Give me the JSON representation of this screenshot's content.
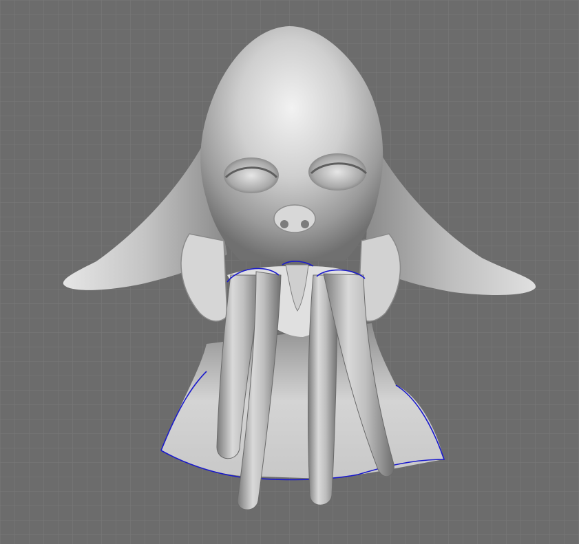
{
  "viewport": {
    "background_color": "#6d6d6d",
    "grid_color": "#7f7f7f",
    "model": "creature-head-bust",
    "model_colors": {
      "skin_light": "#e8e8e8",
      "skin_mid": "#bdbdbd",
      "skin_dark": "#6a6a6a",
      "selection_outline": "#1a1acc"
    }
  }
}
